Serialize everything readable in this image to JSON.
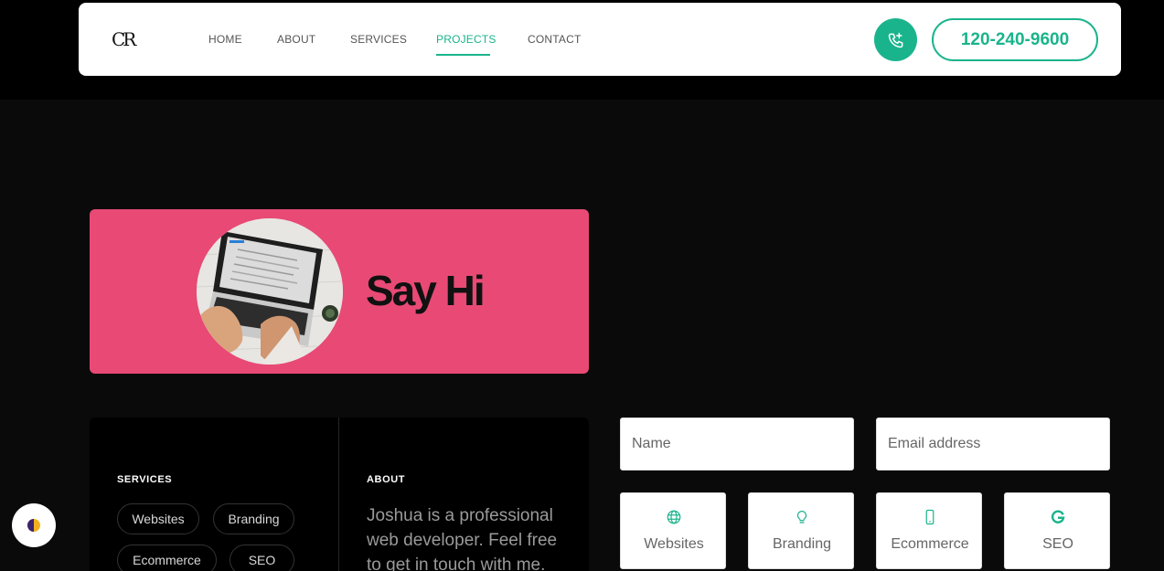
{
  "nav": {
    "logo": "CR",
    "links": [
      "HOME",
      "ABOUT",
      "SERVICES",
      "PROJECTS",
      "CONTACT"
    ],
    "active": "PROJECTS",
    "phone": "120-240-9600",
    "phone_icon": "phone-plus-icon"
  },
  "hero": {
    "title": "Say Hi",
    "image": "laptop-typing-photo"
  },
  "services_panel": {
    "heading": "SERVICES",
    "tags": [
      "Websites",
      "Branding",
      "Ecommerce",
      "SEO"
    ]
  },
  "about_panel": {
    "heading": "ABOUT",
    "text": "Joshua is a professional web developer. Feel free to get in touch with me."
  },
  "form": {
    "name_placeholder": "Name",
    "email_placeholder": "Email address",
    "service_options": [
      {
        "label": "Websites",
        "icon": "globe-icon"
      },
      {
        "label": "Branding",
        "icon": "lightbulb-icon"
      },
      {
        "label": "Ecommerce",
        "icon": "mobile-icon"
      },
      {
        "label": "SEO",
        "icon": "google-icon"
      }
    ]
  },
  "colors": {
    "accent": "#1ab48c",
    "hero_bg": "#e84a75",
    "page_bg": "#0a0a0a"
  }
}
